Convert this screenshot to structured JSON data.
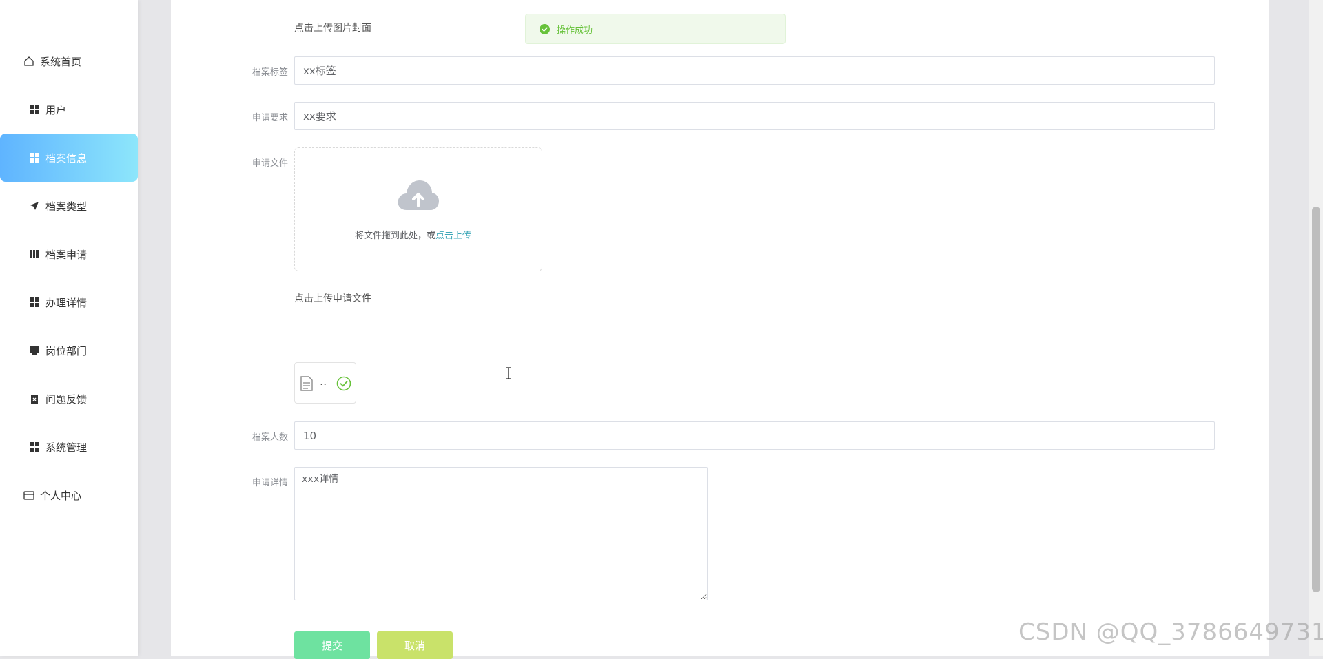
{
  "sidebar": {
    "items": [
      {
        "label": "系统首页",
        "icon": "home-icon"
      },
      {
        "label": "用户",
        "icon": "grid-icon"
      },
      {
        "label": "档案信息",
        "icon": "grid-icon",
        "active": true
      },
      {
        "label": "档案类型",
        "icon": "send-icon"
      },
      {
        "label": "档案申请",
        "icon": "book-icon"
      },
      {
        "label": "办理详情",
        "icon": "grid-icon"
      },
      {
        "label": "岗位部门",
        "icon": "monitor-icon"
      },
      {
        "label": "问题反馈",
        "icon": "clipboard-x-icon"
      },
      {
        "label": "系统管理",
        "icon": "grid-icon"
      },
      {
        "label": "个人中心",
        "icon": "card-icon"
      }
    ]
  },
  "toast": {
    "message": "操作成功",
    "color": "#67c23a"
  },
  "form": {
    "cover_hint": "点击上传图片封面",
    "tag": {
      "label": "档案标签",
      "value": "xx标签"
    },
    "requirement": {
      "label": "申请要求",
      "value": "xx要求"
    },
    "file": {
      "label": "申请文件",
      "drop_text": "将文件拖到此处，或",
      "drop_link": "点击上传",
      "hint": "点击上传申请文件",
      "uploaded_name": ".."
    },
    "count": {
      "label": "档案人数",
      "value": "10"
    },
    "detail": {
      "label": "申请详情",
      "value": "xxx详情"
    },
    "submit_label": "提交",
    "cancel_label": "取消"
  },
  "colors": {
    "active_gradient_start": "#5fb4ff",
    "active_gradient_end": "#8de6fb",
    "submit": "#6ee2a0",
    "cancel": "#c9e26a",
    "link": "#3fa8b8"
  },
  "watermark": "CSDN @QQ_3786649731"
}
